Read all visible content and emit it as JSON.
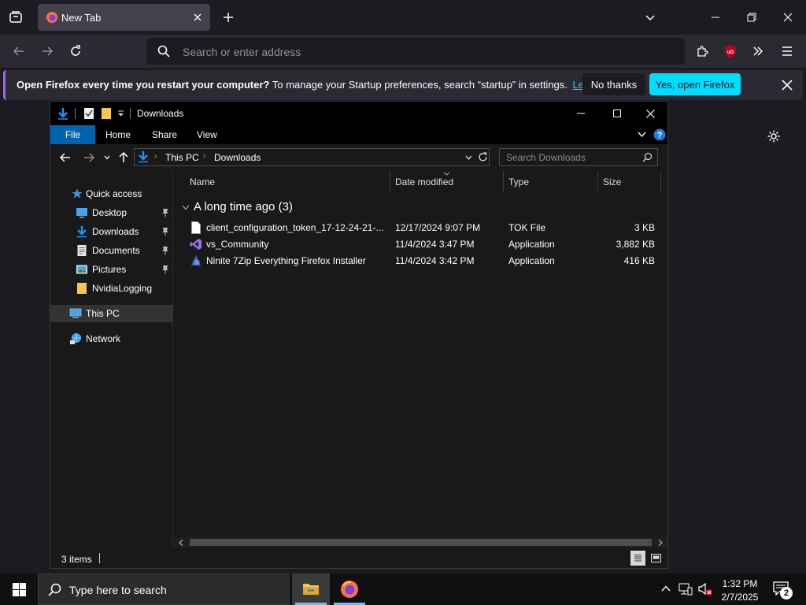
{
  "browser": {
    "tab": {
      "title": "New Tab"
    },
    "address_placeholder": "Search or enter address",
    "notification": {
      "bold": "Open Firefox every time you restart your computer?",
      "text": "To manage your Startup preferences, search “startup” in settings.",
      "link": "Learn more",
      "decline": "No thanks",
      "accept": "Yes, open Firefox"
    },
    "accent": "#00ddff"
  },
  "explorer": {
    "title": "Downloads",
    "ribbon": {
      "file": "File",
      "tabs": [
        "Home",
        "Share",
        "View"
      ]
    },
    "breadcrumb": [
      "This PC",
      "Downloads"
    ],
    "search_placeholder": "Search Downloads",
    "nav": {
      "quick_access": "Quick access",
      "items": [
        "Desktop",
        "Downloads",
        "Documents",
        "Pictures",
        "NvidiaLogging"
      ],
      "this_pc": "This PC",
      "network": "Network"
    },
    "columns": [
      "Name",
      "Date modified",
      "Type",
      "Size"
    ],
    "group": "A long time ago (3)",
    "files": [
      {
        "name": "client_configuration_token_17-12-24-21-...",
        "date": "12/17/2024 9:07 PM",
        "type": "TOK File",
        "size": "3 KB",
        "icon": "document-icon"
      },
      {
        "name": "vs_Community",
        "date": "11/4/2024 3:47 PM",
        "type": "Application",
        "size": "3,882 KB",
        "icon": "visual-studio-icon"
      },
      {
        "name": "Ninite 7Zip Everything Firefox Installer",
        "date": "11/4/2024 3:42 PM",
        "type": "Application",
        "size": "416 KB",
        "icon": "ninite-icon"
      }
    ],
    "status": "3 items"
  },
  "taskbar": {
    "search_placeholder": "Type here to search",
    "time": "1:32 PM",
    "date": "2/7/2025",
    "notification_count": "2"
  }
}
